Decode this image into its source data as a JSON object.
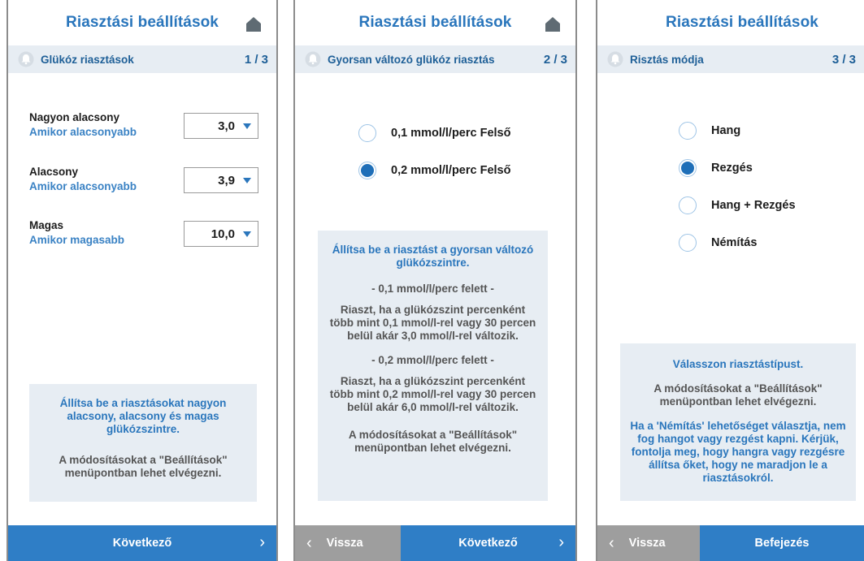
{
  "colors": {
    "accent": "#2a76bc",
    "subbar": "#e7edf3",
    "next_button": "#2f7ec6",
    "back_button": "#9e9e9e"
  },
  "panel1": {
    "title": "Riasztási beállítások",
    "subtitle": "Glükóz riasztások",
    "step": "1 / 3",
    "rows": [
      {
        "label": "Nagyon alacsony",
        "sub": "Amikor alacsonyabb",
        "value": "3,0"
      },
      {
        "label": "Alacsony",
        "sub": "Amikor alacsonyabb",
        "value": "3,9"
      },
      {
        "label": "Magas",
        "sub": "Amikor magasabb",
        "value": "10,0"
      }
    ],
    "info_blue": "Állítsa be a riasztásokat nagyon alacsony, alacsony és magas glükózszintre.",
    "info_grey": "A módosításokat a \"Beállítások\" menüpontban lehet elvégezni.",
    "next_label": "Következő"
  },
  "panel2": {
    "title": "Riasztási beállítások",
    "subtitle": "Gyorsan változó glükóz riasztás",
    "step": "2 / 3",
    "options": [
      {
        "label": "0,1 mmol/l/perc Felső",
        "selected": false
      },
      {
        "label": "0,2 mmol/l/perc Felső",
        "selected": true
      }
    ],
    "info_blue": "Állítsa be a riasztást a gyorsan változó glükózszintre.",
    "info_h1": "- 0,1 mmol/l/perc felett -",
    "info_p1": "Riaszt, ha a glükózszint percenként több mint 0,1 mmol/l-rel vagy 30 percen belül akár 3,0 mmol/l-rel változik.",
    "info_h2": "- 0,2 mmol/l/perc felett -",
    "info_p2": "Riaszt, ha a glükózszint percenként több mint 0,2 mmol/l-rel vagy 30 percen belül akár 6,0 mmol/l-rel változik.",
    "info_grey": "A módosításokat a \"Beállítások\" menüpontban lehet elvégezni.",
    "back_label": "Vissza",
    "next_label": "Következő"
  },
  "panel3": {
    "title": "Riasztási beállítások",
    "subtitle": "Risztás módja",
    "step": "3 / 3",
    "options": [
      {
        "label": "Hang",
        "selected": false
      },
      {
        "label": "Rezgés",
        "selected": true
      },
      {
        "label": "Hang + Rezgés",
        "selected": false
      },
      {
        "label": "Némítás",
        "selected": false
      }
    ],
    "info_blue": "Válasszon riasztástípust.",
    "info_grey": "A módosításokat a \"Beállítások\" menüpontban lehet elvégezni.",
    "info_warn": "Ha a 'Némítás' lehetőséget választja, nem fog hangot vagy rezgést kapni. Kérjük, fontolja meg, hogy hangra vagy rezgésre állítsa őket, hogy ne maradjon le a riasztásokról.",
    "back_label": "Vissza",
    "finish_label": "Befejezés"
  }
}
